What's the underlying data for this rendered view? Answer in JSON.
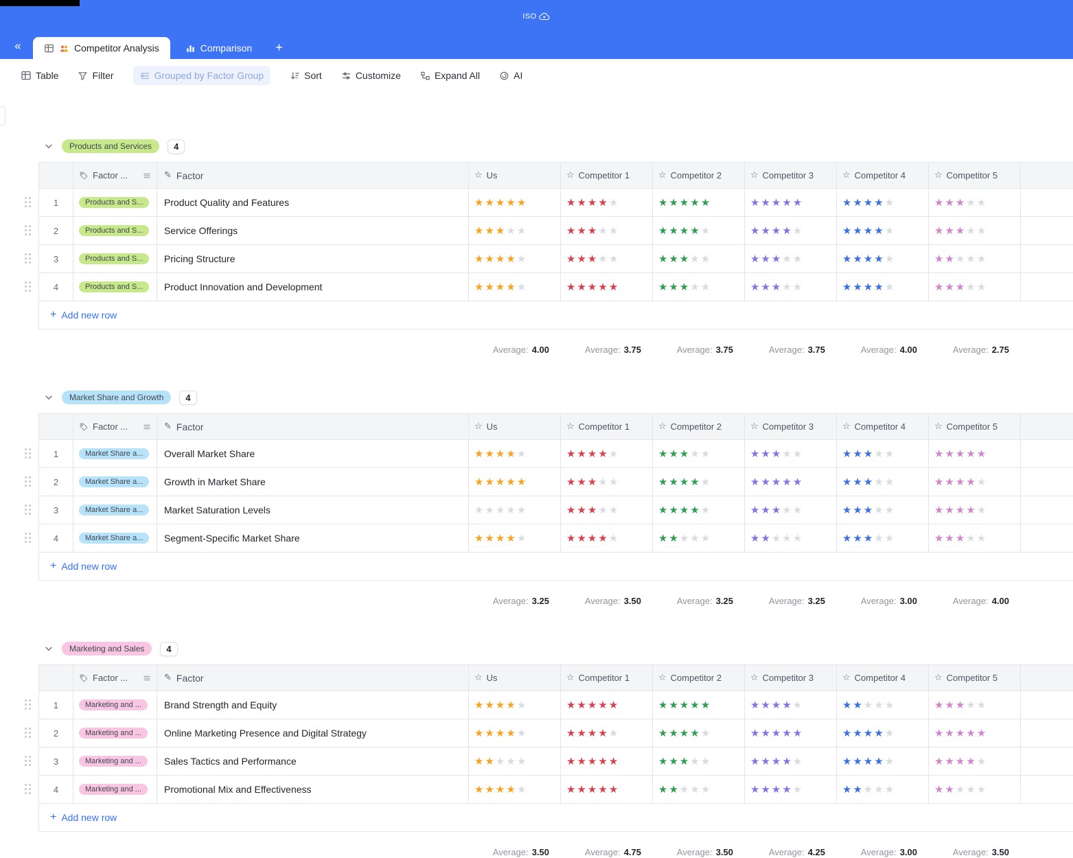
{
  "topbar": {
    "logo_text": "ISO"
  },
  "tabbar": {
    "collapse_icon": "«",
    "tabs": [
      {
        "label": "Competitor Analysis"
      },
      {
        "label": "Comparison"
      }
    ],
    "add_tab_label": "+"
  },
  "toolbar": {
    "items": [
      {
        "label": "Table"
      },
      {
        "label": "Filter"
      },
      {
        "label": "Grouped by Factor Group"
      },
      {
        "label": "Sort"
      },
      {
        "label": "Customize"
      },
      {
        "label": "Expand All"
      },
      {
        "label": "AI"
      }
    ]
  },
  "table_columns": {
    "factor_group_label": "Factor ...",
    "factor_label": "Factor",
    "rating_labels": [
      "Us",
      "Competitor 1",
      "Competitor 2",
      "Competitor 3",
      "Competitor 4",
      "Competitor 5"
    ]
  },
  "star_colors": {
    "columns": [
      "#F7A320",
      "#D9404D",
      "#2E9E50",
      "#8273E6",
      "#3B70E0",
      "#CF86CC"
    ],
    "empty": "#D8DBDF"
  },
  "average_label": "Average:",
  "add_row_label": "Add new row",
  "groups": [
    {
      "name": "Products and Services",
      "count": "4",
      "color": "#C7E98B",
      "tag_label": "Products and S...",
      "rows": [
        {
          "num": "1",
          "factor": "Product Quality and Features",
          "ratings": [
            5,
            4,
            5,
            5,
            4,
            3
          ]
        },
        {
          "num": "2",
          "factor": "Service Offerings",
          "ratings": [
            3,
            3,
            4,
            4,
            4,
            3
          ]
        },
        {
          "num": "3",
          "factor": "Pricing Structure",
          "ratings": [
            4,
            3,
            3,
            3,
            4,
            2
          ]
        },
        {
          "num": "4",
          "factor": "Product Innovation and Development",
          "ratings": [
            4,
            5,
            3,
            3,
            4,
            3
          ]
        }
      ],
      "averages": [
        "4.00",
        "3.75",
        "3.75",
        "3.75",
        "4.00",
        "2.75"
      ]
    },
    {
      "name": "Market Share and Growth",
      "count": "4",
      "color": "#B6E3F9",
      "tag_label": "Market Share a...",
      "rows": [
        {
          "num": "1",
          "factor": "Overall Market Share",
          "ratings": [
            4,
            4,
            3,
            3,
            3,
            5
          ]
        },
        {
          "num": "2",
          "factor": "Growth in Market Share",
          "ratings": [
            5,
            3,
            4,
            5,
            3,
            4
          ]
        },
        {
          "num": "3",
          "factor": "Market Saturation Levels",
          "ratings": [
            0,
            3,
            4,
            3,
            3,
            4
          ]
        },
        {
          "num": "4",
          "factor": "Segment-Specific Market Share",
          "ratings": [
            4,
            4,
            2,
            2,
            3,
            3
          ]
        }
      ],
      "averages": [
        "3.25",
        "3.50",
        "3.25",
        "3.25",
        "3.00",
        "4.00"
      ]
    },
    {
      "name": "Marketing and Sales",
      "count": "4",
      "color": "#F8C6E2",
      "tag_label": "Marketing and ...",
      "rows": [
        {
          "num": "1",
          "factor": "Brand Strength and Equity",
          "ratings": [
            4,
            5,
            5,
            4,
            2,
            3
          ]
        },
        {
          "num": "2",
          "factor": "Online Marketing Presence and Digital Strategy",
          "ratings": [
            4,
            4,
            4,
            5,
            4,
            5
          ]
        },
        {
          "num": "3",
          "factor": "Sales Tactics and Performance",
          "ratings": [
            2,
            5,
            3,
            4,
            4,
            4
          ]
        },
        {
          "num": "4",
          "factor": "Promotional Mix and Effectiveness",
          "ratings": [
            4,
            5,
            2,
            4,
            2,
            2
          ]
        }
      ],
      "averages": [
        "3.50",
        "4.75",
        "3.50",
        "4.25",
        "3.00",
        "3.50"
      ]
    }
  ]
}
